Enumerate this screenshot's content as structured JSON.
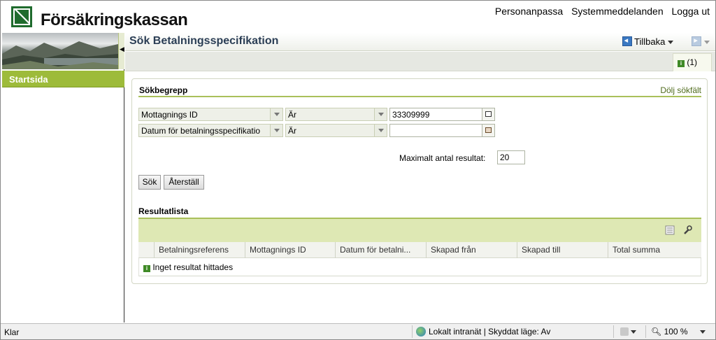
{
  "header": {
    "brand": "Försäkringskassan",
    "links": [
      "Personanpassa",
      "Systemmeddelanden",
      "Logga ut"
    ]
  },
  "sidebar": {
    "items": [
      {
        "label": "Startsida"
      }
    ]
  },
  "title_bar": {
    "title": "Sök Betalningsspecifikation",
    "back_label": "Tillbaka"
  },
  "info_tab": {
    "count": "(1)"
  },
  "search": {
    "section_title": "Sökbegrepp",
    "hide_link": "Dölj sökfält",
    "rows": [
      {
        "field": "Mottagnings ID",
        "operator": "Är",
        "value": "33309999"
      },
      {
        "field": "Datum för betalningsspecifikatio",
        "operator": "Är",
        "value": ""
      }
    ],
    "max_label": "Maximalt antal resultat:",
    "max_value": "20",
    "search_button": "Sök",
    "reset_button": "Återställ"
  },
  "results": {
    "title": "Resultatlista",
    "columns": [
      "Betalningsreferens",
      "Mottagnings ID",
      "Datum för betalni...",
      "Skapad från",
      "Skapad till",
      "Total summa"
    ],
    "empty_message": "Inget resultat hittades"
  },
  "status_bar": {
    "left": "Klar",
    "zone": "Lokalt intranät | Skyddat läge: Av",
    "zoom": "100 %"
  },
  "colors": {
    "accent_green": "#9dbb3a",
    "title_blue": "#2b3e55",
    "logo_green": "#1f6b2d"
  }
}
